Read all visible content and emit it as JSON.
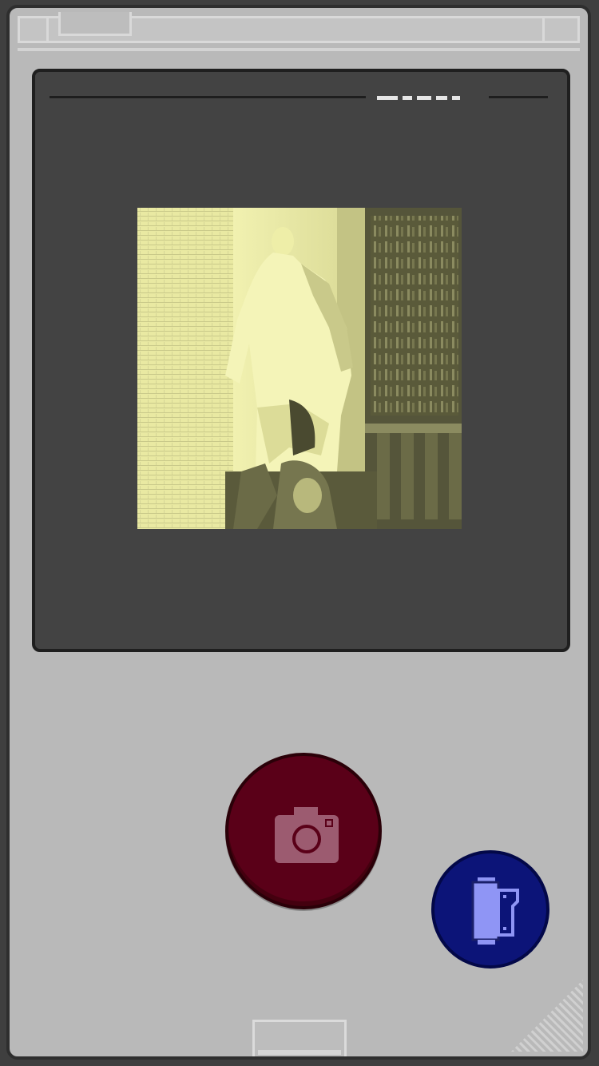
{
  "screen": {
    "photo_subject": "statue-photo"
  },
  "controls": {
    "shutter_icon": "camera-icon",
    "gallery_icon": "film-roll-icon"
  },
  "colors": {
    "device_body": "#b9b9b9",
    "screen_bezel": "#434343",
    "shutter_button": "#5a0018",
    "gallery_button": "#0c1478",
    "photo_palette_light": "#eeeea6",
    "photo_palette_dark": "#4d4d32"
  }
}
